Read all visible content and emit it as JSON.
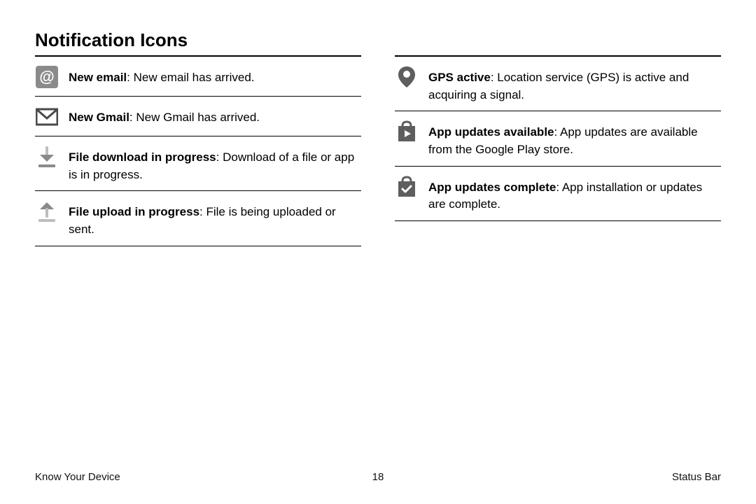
{
  "title": "Notification Icons",
  "left": [
    {
      "icon": "at",
      "label": "New email",
      "desc": ": New email has arrived."
    },
    {
      "icon": "gmail",
      "label": "New Gmail",
      "desc": ": New Gmail has arrived."
    },
    {
      "icon": "download",
      "label": "File download in progress",
      "desc": ": Download of a file or app is in progress."
    },
    {
      "icon": "upload",
      "label": "File upload in progress",
      "desc": ": File is being uploaded or sent."
    }
  ],
  "right": [
    {
      "icon": "gps",
      "label": "GPS active",
      "desc": ": Location service (GPS) is active and acquiring a signal."
    },
    {
      "icon": "bag-play",
      "label": "App updates available",
      "desc": ": App updates are available from the Google Play store."
    },
    {
      "icon": "bag-check",
      "label": "App updates complete",
      "desc": ": App installation or updates are complete."
    }
  ],
  "footer": {
    "left": "Know Your Device",
    "page": "18",
    "right": "Status Bar"
  }
}
